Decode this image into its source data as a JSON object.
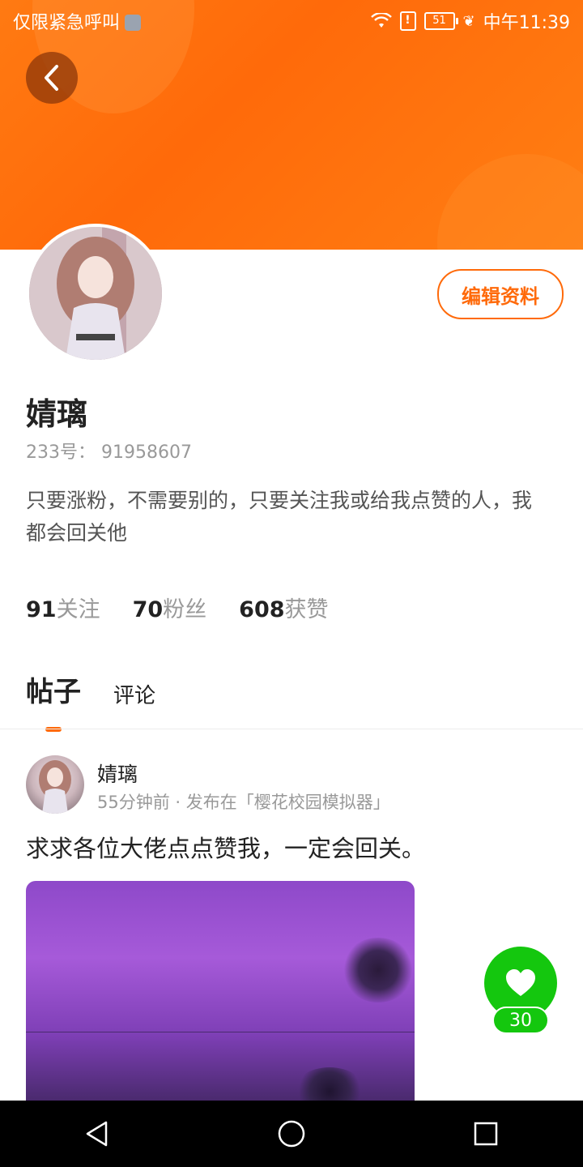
{
  "statusbar": {
    "left_text": "仅限紧急呼叫",
    "battery": "51",
    "time": "中午11:39"
  },
  "profile": {
    "name": "婧璃",
    "uid": "233号： 91958607",
    "bio": "只要涨粉，不需要别的，只要关注我或给我点赞的人，我都会回关他",
    "edit_label": "编辑资料"
  },
  "stats": [
    {
      "num": "91",
      "label": "关注"
    },
    {
      "num": "70",
      "label": "粉丝"
    },
    {
      "num": "608",
      "label": "获赞"
    }
  ],
  "tabs": {
    "posts": "帖子",
    "comments": "评论"
  },
  "post": {
    "author": "婧璃",
    "meta": "55分钟前 · 发布在「樱花校园模拟器」",
    "text": "求求各位大佬点点赞我，一定会回关。",
    "likes": "30"
  },
  "colors": {
    "accent": "#ff6a0a",
    "like": "#14c70e"
  },
  "icons": [
    "back-arrow-icon",
    "heart-icon",
    "nav-back-icon",
    "nav-home-icon",
    "nav-recents-icon"
  ]
}
